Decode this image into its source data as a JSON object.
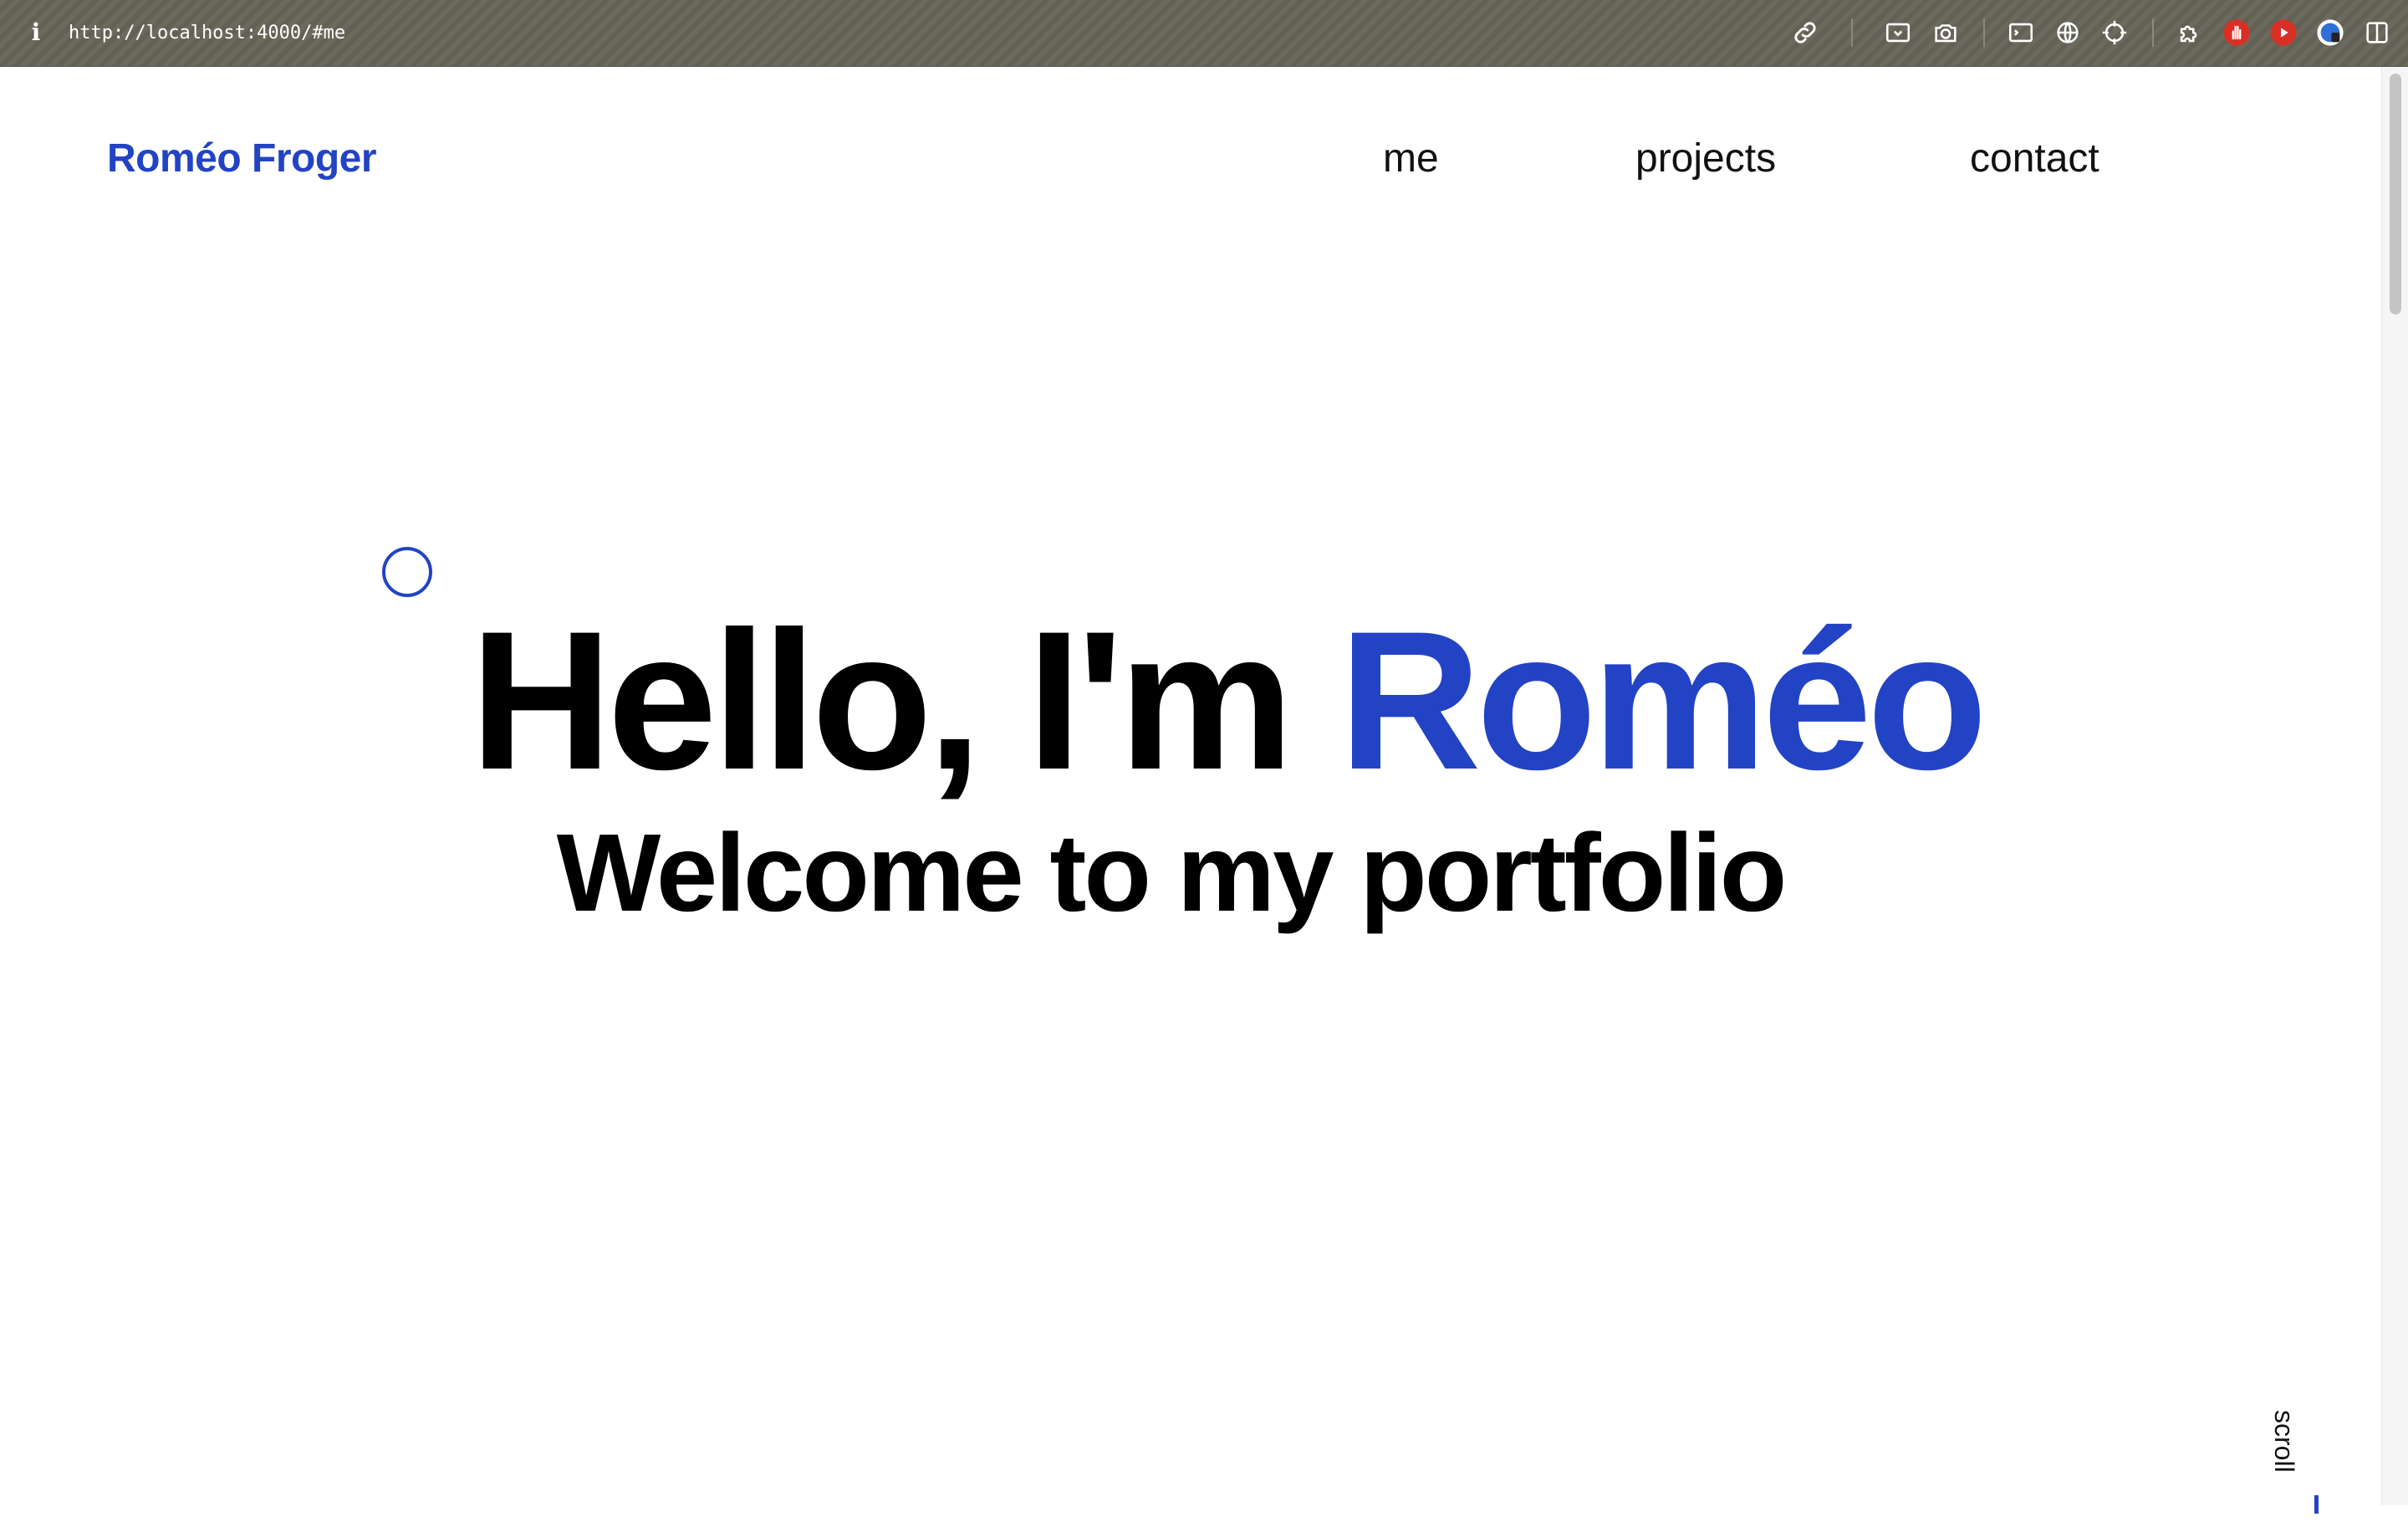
{
  "browser": {
    "url": "http://localhost:4000/#me",
    "info_icon": "i",
    "toolbar_icons": [
      "link-icon",
      "screenshot-area-icon",
      "camera-icon",
      "terminal-icon",
      "globe-icon",
      "crosshair-icon",
      "extension-icon",
      "stop-hand-icon",
      "youtube-play-icon",
      "profile-avatar-icon",
      "sidebar-toggle-icon"
    ]
  },
  "header": {
    "logo": "Roméo Froger",
    "nav": [
      {
        "label": "me"
      },
      {
        "label": "projects"
      },
      {
        "label": "contact"
      }
    ]
  },
  "hero": {
    "greeting": "Hello, I'm ",
    "name": "Roméo",
    "subtitle": "Welcome to my portfolio"
  },
  "scroll_hint": "scroll",
  "colors": {
    "accent": "#2343c5",
    "text": "#000000",
    "background": "#ffffff",
    "browser_bar": "#66655a"
  }
}
